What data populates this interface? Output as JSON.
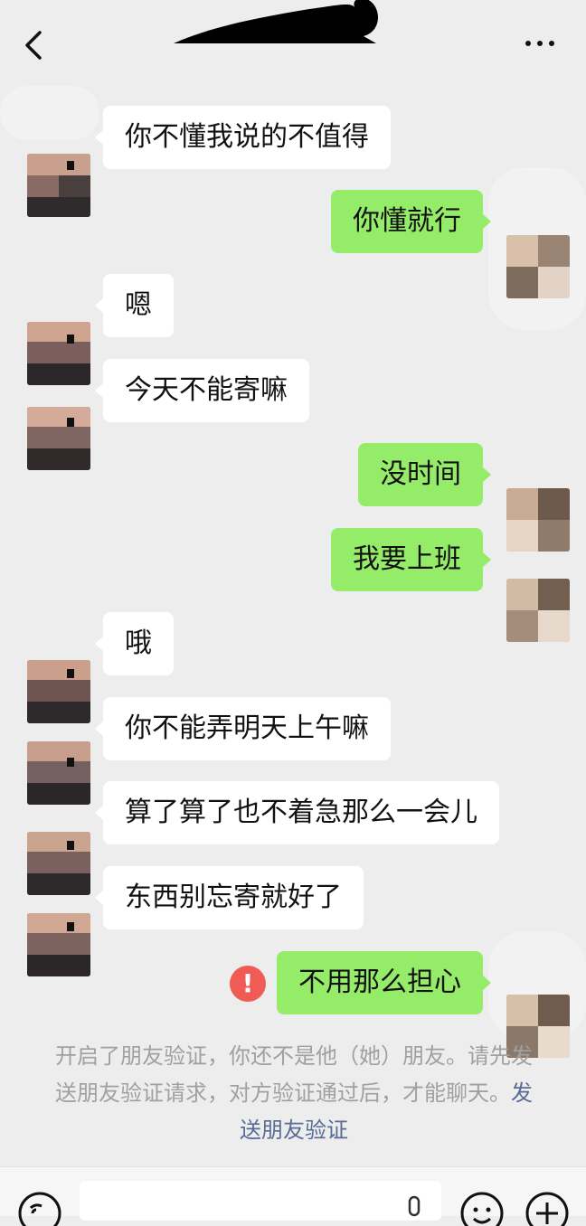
{
  "header": {
    "back": "back",
    "more": "more"
  },
  "messages": [
    {
      "side": "in",
      "text": "你不懂我说的不值得"
    },
    {
      "side": "out",
      "text": "你懂就行"
    },
    {
      "side": "in",
      "text": "嗯"
    },
    {
      "side": "in",
      "text": "今天不能寄嘛"
    },
    {
      "side": "out",
      "text": "没时间"
    },
    {
      "side": "out",
      "text": "我要上班"
    },
    {
      "side": "in",
      "text": "哦"
    },
    {
      "side": "in",
      "text": "你不能弄明天上午嘛"
    },
    {
      "side": "in",
      "text": "算了算了也不着急那么一会儿"
    },
    {
      "side": "in",
      "text": "东西别忘寄就好了"
    },
    {
      "side": "out",
      "text": "不用那么担心",
      "failed": true
    }
  ],
  "error_badge": "!",
  "system_note": {
    "text": "开启了朋友验证，你还不是他（她）朋友。请先发送朋友验证请求，对方验证通过后，才能聊天。",
    "link": "发送朋友验证"
  },
  "colors": {
    "background": "#ededed",
    "bubble_in": "#ffffff",
    "bubble_out": "#95ec69",
    "link": "#576b95",
    "error": "#f05b56"
  },
  "icons": [
    "back-icon",
    "more-icon",
    "voice-icon",
    "mic-icon",
    "emoji-icon",
    "plus-icon"
  ]
}
